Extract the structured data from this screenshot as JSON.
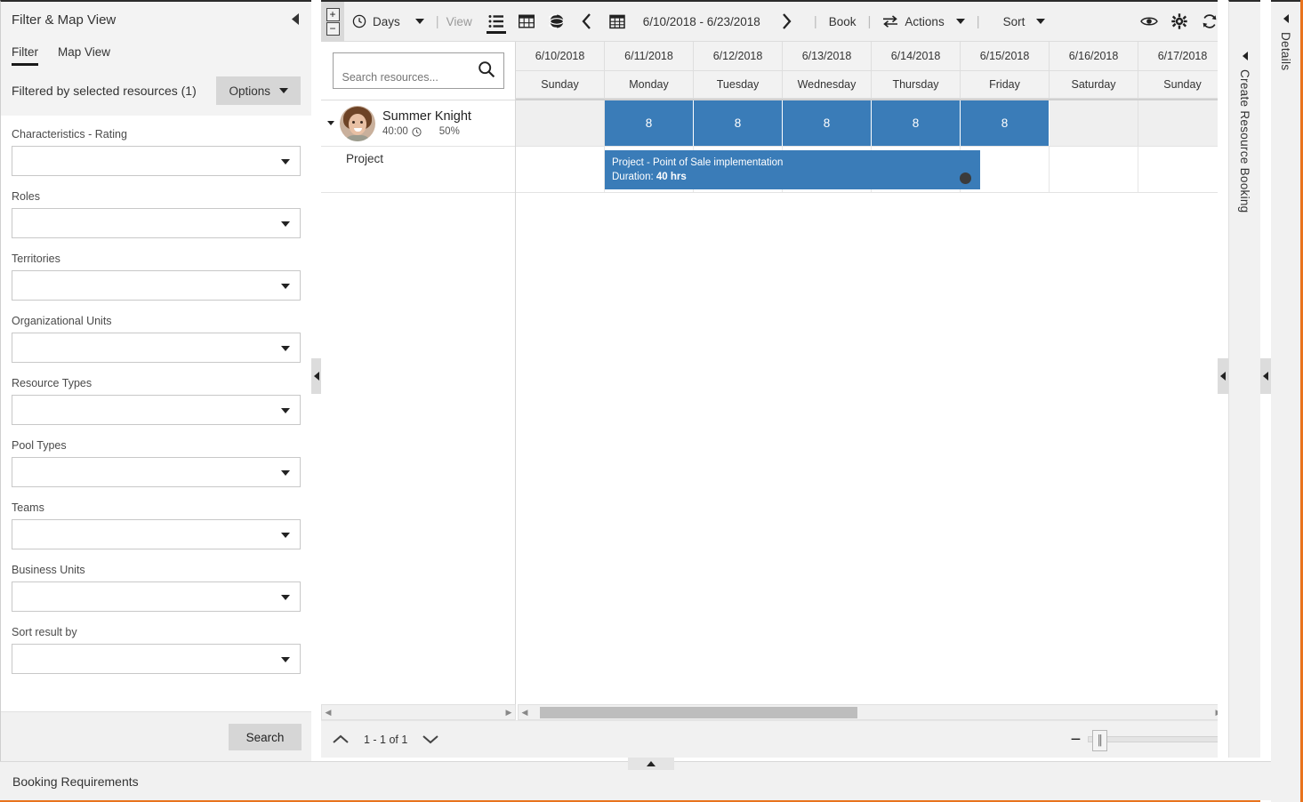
{
  "filter_panel": {
    "title": "Filter & Map View",
    "collapse_icon": "chevron-left-icon",
    "tabs": [
      {
        "label": "Filter",
        "active": true
      },
      {
        "label": "Map View",
        "active": false
      }
    ],
    "filtered_by_label": "Filtered by selected resources (1)",
    "options_button": "Options",
    "fields": [
      {
        "label": "Characteristics - Rating",
        "value": "",
        "name": "characteristics-rating"
      },
      {
        "label": "Roles",
        "value": "",
        "name": "roles"
      },
      {
        "label": "Territories",
        "value": "",
        "name": "territories"
      },
      {
        "label": "Organizational Units",
        "value": "",
        "name": "organizational-units"
      },
      {
        "label": "Resource Types",
        "value": "",
        "name": "resource-types"
      },
      {
        "label": "Pool Types",
        "value": "",
        "name": "pool-types"
      },
      {
        "label": "Teams",
        "value": "",
        "name": "teams"
      },
      {
        "label": "Business Units",
        "value": "",
        "name": "business-units"
      },
      {
        "label": "Sort result by",
        "value": "",
        "name": "sort-result-by"
      }
    ],
    "search_button": "Search"
  },
  "toolbar": {
    "zoom_in": "+",
    "zoom_out": "−",
    "scale_label": "Days",
    "view_label": "View",
    "date_range": "6/10/2018 - 6/23/2018",
    "book_label": "Book",
    "actions_label": "Actions",
    "sort_label": "Sort",
    "separator": "|",
    "icons": {
      "clock": "clock-icon",
      "list_view": "list-view-icon",
      "grid_view": "grid-view-icon",
      "map_view": "globe-view-icon",
      "prev": "chevron-left-icon",
      "calendar": "calendar-icon",
      "next": "chevron-right-icon",
      "swap": "swap-arrows-icon",
      "eye": "eye-icon",
      "settings": "gear-icon",
      "refresh": "refresh-icon",
      "expand": "expand-diagonal-icon"
    }
  },
  "resource_panel": {
    "search_placeholder": "Search resources...",
    "search_value": "",
    "search_icon": "search-icon",
    "resource": {
      "name": "Summer Knight",
      "hours": "40:00",
      "clock_icon": "clock-icon",
      "utilization": "50%",
      "child_row": "Project"
    }
  },
  "schedule": {
    "columns": [
      {
        "date": "6/10/2018",
        "day": "Sunday",
        "capacity": "",
        "filled": false
      },
      {
        "date": "6/11/2018",
        "day": "Monday",
        "capacity": "8",
        "filled": true
      },
      {
        "date": "6/12/2018",
        "day": "Tuesday",
        "capacity": "8",
        "filled": true
      },
      {
        "date": "6/13/2018",
        "day": "Wednesday",
        "capacity": "8",
        "filled": true
      },
      {
        "date": "6/14/2018",
        "day": "Thursday",
        "capacity": "8",
        "filled": true
      },
      {
        "date": "6/15/2018",
        "day": "Friday",
        "capacity": "8",
        "filled": true
      },
      {
        "date": "6/16/2018",
        "day": "Saturday",
        "capacity": "",
        "filled": false
      },
      {
        "date": "6/17/2018",
        "day": "Sunday",
        "capacity": "",
        "filled": false
      }
    ],
    "booking": {
      "title": "Project - Point of Sale implementation",
      "duration_label": "Duration:",
      "duration_value": "40 hrs",
      "color": "#3a7cb8",
      "status_dot": "status-dot-icon"
    }
  },
  "footer": {
    "pager_text": "1 - 1 of 1",
    "up_icon": "chevron-up-icon",
    "down_icon": "chevron-down-icon",
    "zoom_out_label": "−",
    "zoom_in_label": "+"
  },
  "right_panels": {
    "create_resource_booking": "Create Resource Booking",
    "details": "Details",
    "collapse_icon": "chevron-left-icon"
  },
  "bottom_bar": {
    "title": "Booking Requirements",
    "collapse_icon": "chevron-up-icon"
  }
}
